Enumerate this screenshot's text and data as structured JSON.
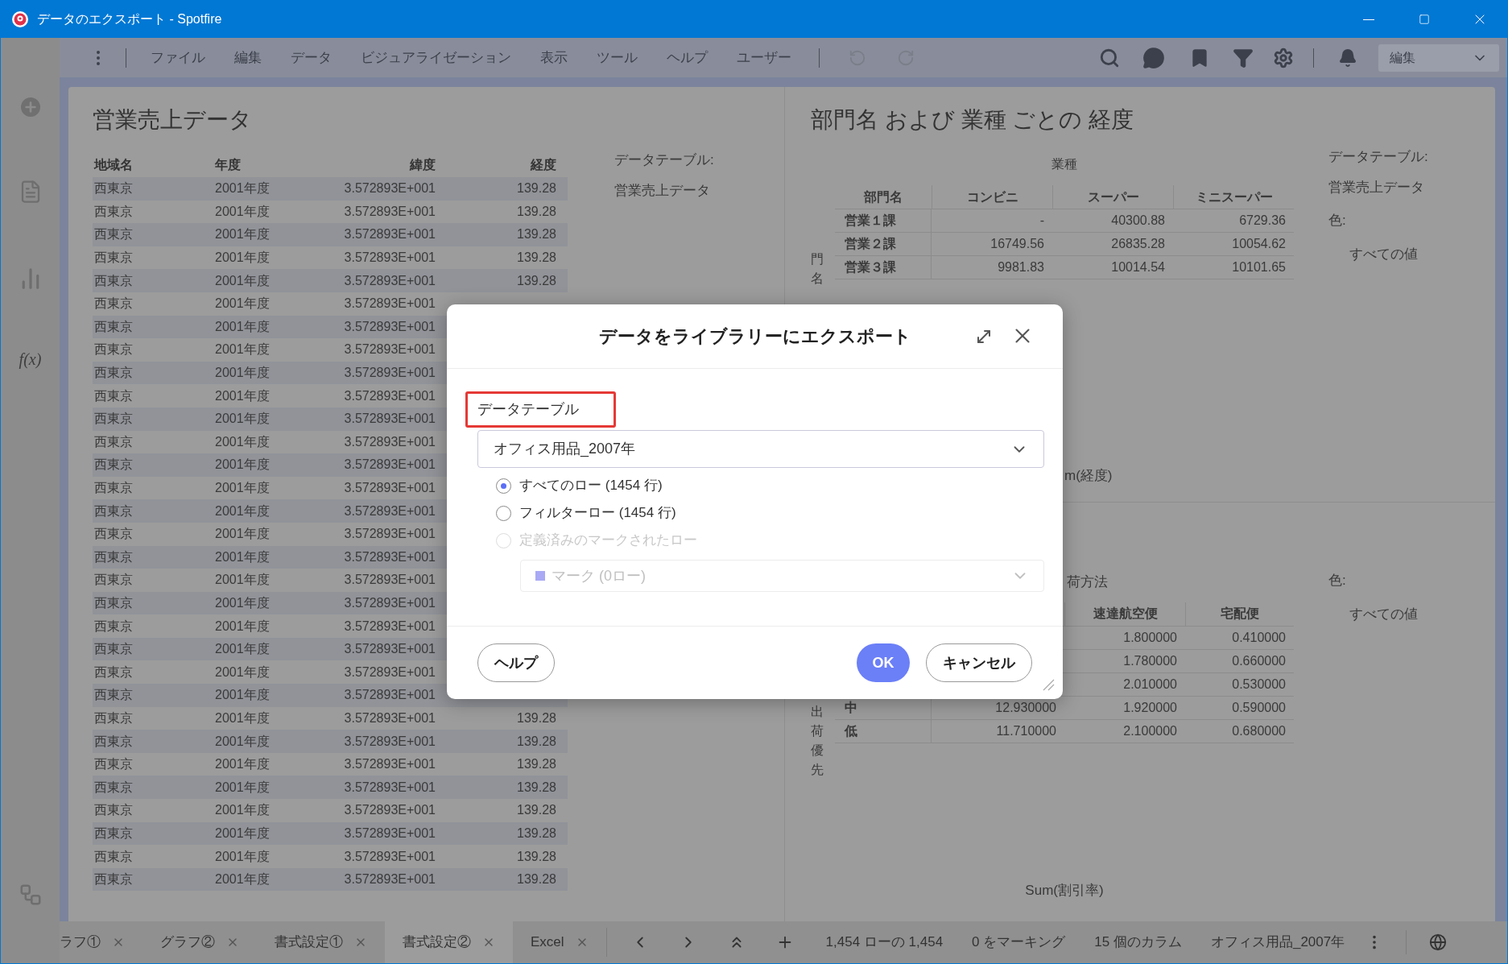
{
  "window": {
    "title": "データのエクスポート - Spotfire"
  },
  "menu": [
    "ファイル",
    "編集",
    "データ",
    "ビジュアライゼーション",
    "表示",
    "ツール",
    "ヘルプ",
    "ユーザー"
  ],
  "mode_dropdown": {
    "value": "編集"
  },
  "sidebar": {
    "formula_label": "f(x)"
  },
  "left_panel": {
    "title": "営業売上データ",
    "table": {
      "columns": [
        "地域名",
        "年度",
        "緯度",
        "経度"
      ],
      "rows": [
        [
          "西東京",
          "2001年度",
          "3.572893E+001",
          "139.28"
        ],
        [
          "西東京",
          "2001年度",
          "3.572893E+001",
          "139.28"
        ],
        [
          "西東京",
          "2001年度",
          "3.572893E+001",
          "139.28"
        ],
        [
          "西東京",
          "2001年度",
          "3.572893E+001",
          "139.28"
        ],
        [
          "西東京",
          "2001年度",
          "3.572893E+001",
          "139.28"
        ],
        [
          "西東京",
          "2001年度",
          "3.572893E+001"
        ],
        [
          "西東京",
          "2001年度",
          "3.572893E+001"
        ],
        [
          "西東京",
          "2001年度",
          "3.572893E+001"
        ],
        [
          "西東京",
          "2001年度",
          "3.572893E+001"
        ],
        [
          "西東京",
          "2001年度",
          "3.572893E+001"
        ],
        [
          "西東京",
          "2001年度",
          "3.572893E+001"
        ],
        [
          "西東京",
          "2001年度",
          "3.572893E+001"
        ],
        [
          "西東京",
          "2001年度",
          "3.572893E+001"
        ],
        [
          "西東京",
          "2001年度",
          "3.572893E+001"
        ],
        [
          "西東京",
          "2001年度",
          "3.572893E+001"
        ],
        [
          "西東京",
          "2001年度",
          "3.572893E+001"
        ],
        [
          "西東京",
          "2001年度",
          "3.572893E+001"
        ],
        [
          "西東京",
          "2001年度",
          "3.572893E+001"
        ],
        [
          "西東京",
          "2001年度",
          "3.572893E+001"
        ],
        [
          "西東京",
          "2001年度",
          "3.572893E+001"
        ],
        [
          "西東京",
          "2001年度",
          "3.572893E+001"
        ],
        [
          "西東京",
          "2001年度",
          "3.572893E+001"
        ],
        [
          "西東京",
          "2001年度",
          "3.572893E+001"
        ],
        [
          "西東京",
          "2001年度",
          "3.572893E+001",
          "139.28"
        ],
        [
          "西東京",
          "2001年度",
          "3.572893E+001",
          "139.28"
        ],
        [
          "西東京",
          "2001年度",
          "3.572893E+001",
          "139.28"
        ],
        [
          "西東京",
          "2001年度",
          "3.572893E+001",
          "139.28"
        ],
        [
          "西東京",
          "2001年度",
          "3.572893E+001",
          "139.28"
        ],
        [
          "西東京",
          "2001年度",
          "3.572893E+001",
          "139.28"
        ],
        [
          "西東京",
          "2001年度",
          "3.572893E+001",
          "139.28"
        ],
        [
          "西東京",
          "2001年度",
          "3.572893E+001",
          "139.28"
        ]
      ]
    },
    "legend": [
      {
        "label": "データテーブル:",
        "kind": "heading"
      },
      {
        "label": "営業売上データ",
        "kind": "value"
      }
    ]
  },
  "right_panel": {
    "title": "部門名 および 業種 ごとの 経度",
    "cross_table_1": {
      "column_group": "業種",
      "row_axis_label": "門名",
      "columns": [
        "部門名",
        "コンビニ",
        "スーパー",
        "ミニスーパー"
      ],
      "rows": [
        [
          "営業１課",
          "-",
          "40300.88",
          "6729.36"
        ],
        [
          "営業２課",
          "16749.56",
          "26835.28",
          "10054.62"
        ],
        [
          "営業３課",
          "9981.83",
          "10014.54",
          "10101.65"
        ]
      ],
      "value_label": "m(経度)"
    },
    "legend_1": [
      {
        "label": "データテーブル:",
        "kind": "heading"
      },
      {
        "label": "営業売上データ",
        "kind": "value"
      },
      {
        "label": "色:",
        "kind": "heading"
      },
      {
        "label": "すべての値",
        "kind": "indented"
      }
    ],
    "cross_table_2": {
      "column_group": "荷方法",
      "row_axis_label": "出荷優先",
      "columns": [
        "速達航空便",
        "宅配便"
      ],
      "rows": [
        [
          "1.800000",
          "0.410000"
        ],
        [
          "1.780000",
          "0.660000"
        ],
        [
          "2.010000",
          "0.530000"
        ],
        [
          "中",
          "12.930000",
          "1.920000",
          "0.590000"
        ],
        [
          "低",
          "11.710000",
          "2.100000",
          "0.680000"
        ]
      ],
      "value_label": "Sum(割引率)"
    },
    "legend_2": [
      {
        "label": "色:",
        "kind": "heading"
      },
      {
        "label": "すべての値",
        "kind": "indented"
      }
    ]
  },
  "bottom_bar": {
    "tabs": [
      {
        "label": "ラフ①",
        "selected": false
      },
      {
        "label": "グラフ②",
        "selected": false
      },
      {
        "label": "書式設定①",
        "selected": false
      },
      {
        "label": "書式設定②",
        "selected": true
      },
      {
        "label": "Excel",
        "selected": false
      }
    ],
    "status": [
      "1,454 ローの 1,454",
      "0 をマーキング",
      "15 個のカラム",
      "オフィス用品_2007年"
    ]
  },
  "dialog": {
    "title": "データをライブラリーにエクスポート",
    "section_label": "データテーブル",
    "table_select": {
      "value": "オフィス用品_2007年"
    },
    "options": [
      {
        "label": "すべてのロー (1454 行)",
        "selected": true,
        "disabled": false
      },
      {
        "label": "フィルターロー (1454 行)",
        "selected": false,
        "disabled": false
      },
      {
        "label": "定義済みのマークされたロー",
        "selected": false,
        "disabled": true
      }
    ],
    "marking_select": {
      "value": "マーク (0ロー)",
      "color": "#a9a9f5",
      "disabled": true
    },
    "buttons": [
      {
        "label": "ヘルプ",
        "kind": "secondary"
      },
      {
        "label": "OK",
        "kind": "primary"
      },
      {
        "label": "キャンセル",
        "kind": "secondary"
      }
    ]
  }
}
